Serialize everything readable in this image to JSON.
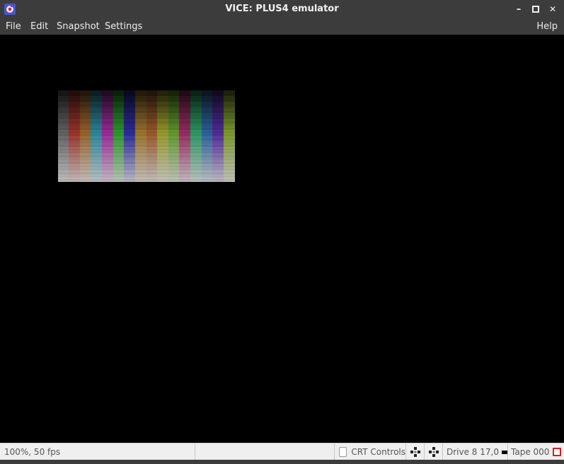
{
  "window": {
    "title": "VICE: PLUS4 emulator",
    "minimize_symbol": "–",
    "close_symbol": "✕"
  },
  "menu": {
    "items": [
      "File",
      "Edit",
      "Snapshot",
      "Settings"
    ],
    "help": "Help"
  },
  "statusbar": {
    "speed": "100%, 50 fps",
    "crt_controls": "CRT Controls",
    "drive": "Drive 8 17,0",
    "tape": "Tape 000"
  },
  "colors": {
    "titlebar_bg": "#3c3c3c",
    "screen_bg": "#000000",
    "statusbar_bg": "#efefef",
    "tape_indicator": "#d41f1f"
  },
  "icons": {
    "app": "vice-logo-icon",
    "joystick": "joystick-icon"
  }
}
